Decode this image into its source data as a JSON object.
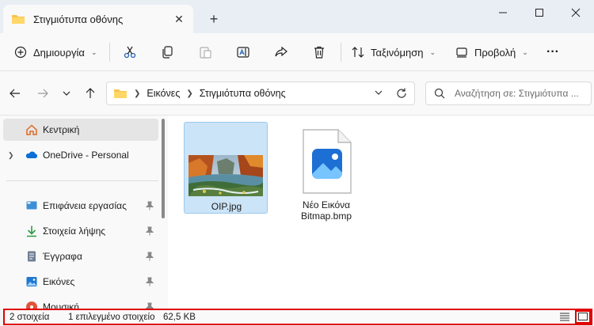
{
  "tab": {
    "title": "Στιγμιότυπα οθόνης",
    "close": "✕",
    "new": "+"
  },
  "commands": {
    "new_label": "Δημιουργία",
    "sort_label": "Ταξινόμηση",
    "view_label": "Προβολή",
    "more": "···"
  },
  "address": {
    "crumbs": [
      "Εικόνες",
      "Στιγμιότυπα οθόνης"
    ],
    "search_placeholder": "Αναζήτηση σε: Στιγμιότυπα ..."
  },
  "sidebar": {
    "items": [
      {
        "label": "Κεντρική",
        "icon": "home-icon"
      },
      {
        "label": "OneDrive - Personal",
        "icon": "onedrive-icon"
      },
      {
        "label": "Επιφάνεια εργασίας",
        "icon": "desktop-icon"
      },
      {
        "label": "Στοιχεία λήψης",
        "icon": "download-icon"
      },
      {
        "label": "Έγγραφα",
        "icon": "documents-icon"
      },
      {
        "label": "Εικόνες",
        "icon": "pictures-icon"
      },
      {
        "label": "Μουσική",
        "icon": "music-icon"
      }
    ]
  },
  "files": [
    {
      "name": "OIP.jpg",
      "selected": true
    },
    {
      "name_line1": "Νέο Εικόνα",
      "name_line2": "Bitmap.bmp",
      "selected": false
    }
  ],
  "status": {
    "count": "2 στοιχεία",
    "selected": "1 επιλεγμένο στοιχείο",
    "size": "62,5 KB"
  },
  "colors": {
    "accent": "#0067c0",
    "selection": "#cce4f7",
    "highlight_border": "#e00000"
  }
}
